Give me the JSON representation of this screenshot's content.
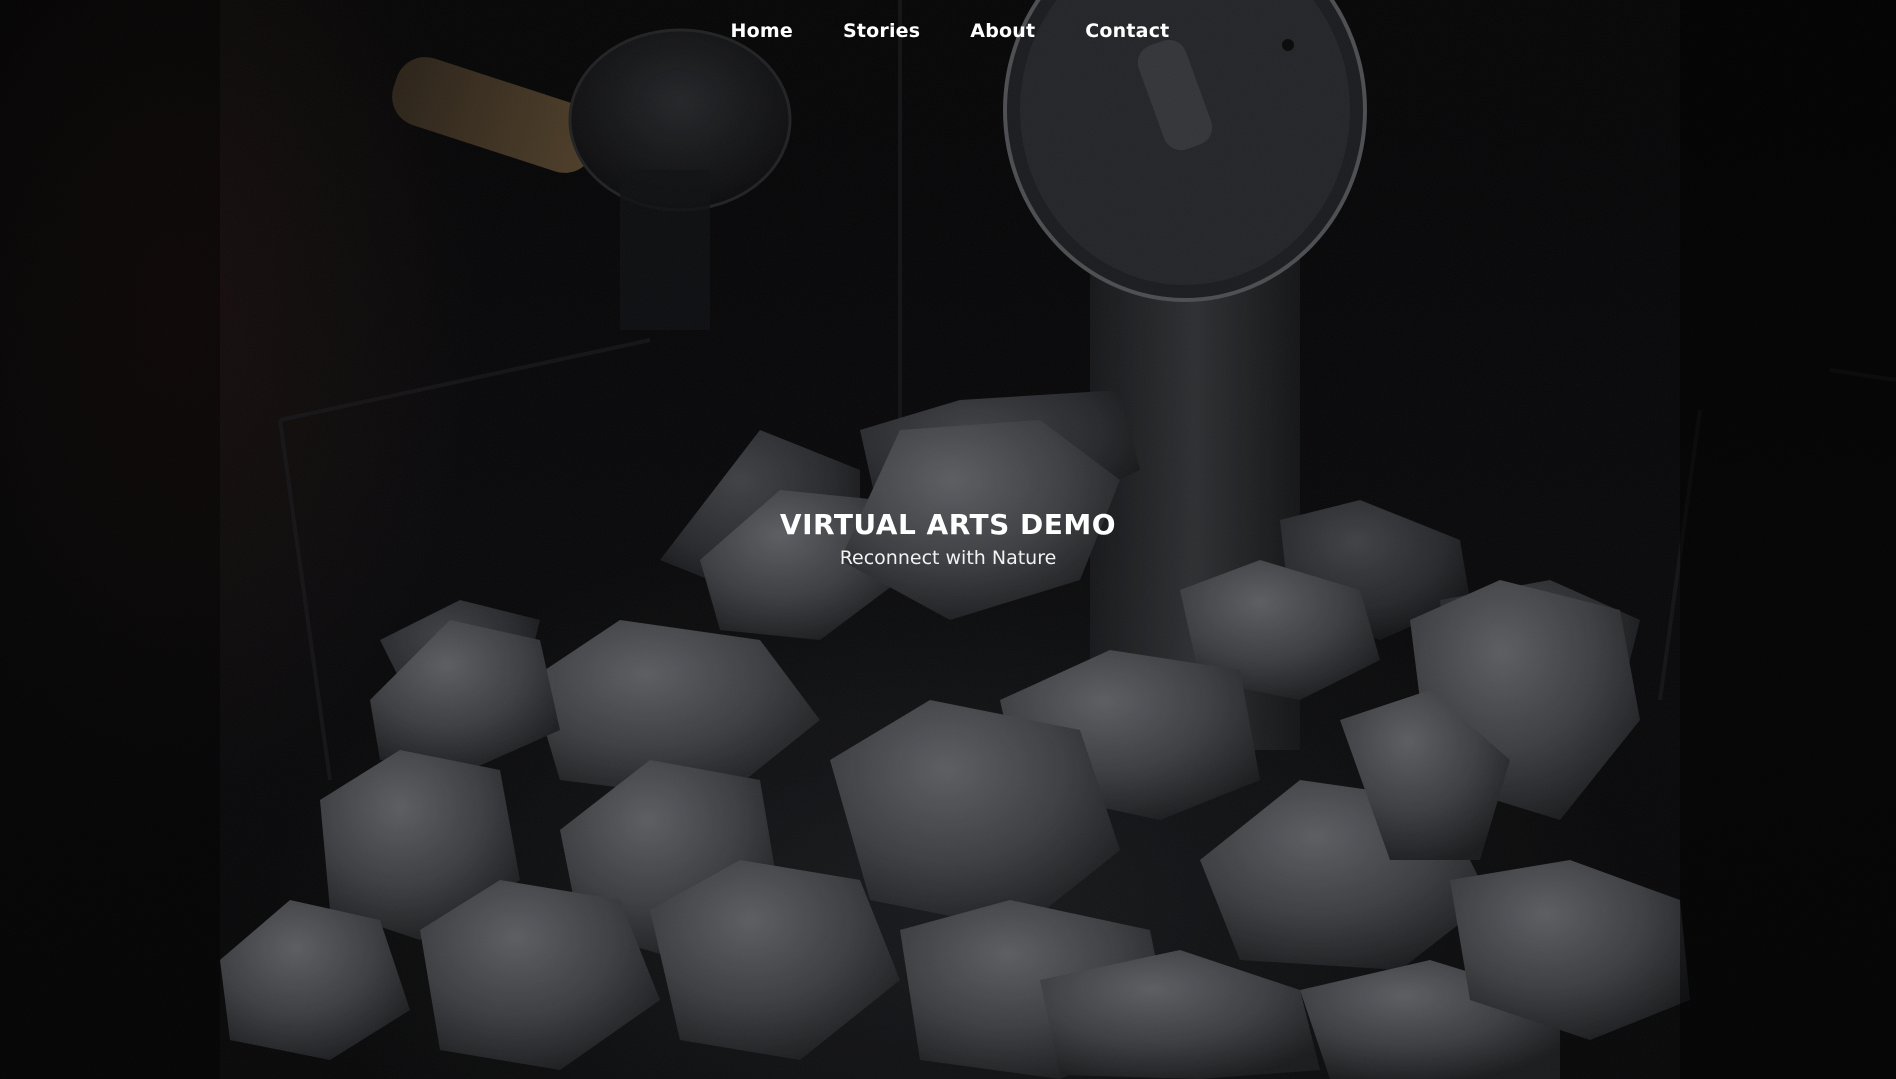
{
  "nav": {
    "items": [
      {
        "label": "Home"
      },
      {
        "label": "Stories"
      },
      {
        "label": "About"
      },
      {
        "label": "Contact"
      }
    ]
  },
  "hero": {
    "title": "VIRTUAL ARTS DEMO",
    "subtitle": "Reconnect with Nature",
    "background_image": "sauna-stones-photo"
  },
  "colors": {
    "background": "#050506",
    "text": "#ffffff",
    "stone": "#4a4c50"
  }
}
